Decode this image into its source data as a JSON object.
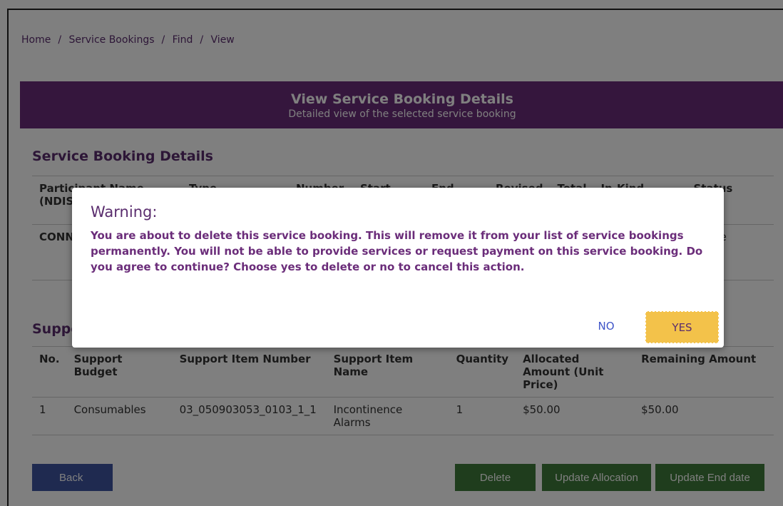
{
  "breadcrumb": [
    "Home",
    "Service Bookings",
    "Find",
    "View"
  ],
  "banner": {
    "title": "View Service Booking Details",
    "subtitle": "Detailed view of the selected service booking"
  },
  "booking_section": {
    "title": "Service Booking Details",
    "headers": [
      "Participant Name (NDIS",
      "Type",
      "Number",
      "Start Date",
      "End Date",
      "Revised",
      "Total",
      "In-Kind Program",
      "Status"
    ],
    "row": [
      "CONN (4302",
      "",
      "",
      "",
      "",
      "",
      "",
      "",
      "Active"
    ]
  },
  "support_section": {
    "title": "Supports",
    "headers": [
      "No.",
      "Support Budget",
      "Support Item Number",
      "Support Item Name",
      "Quantity",
      "Allocated Amount (Unit Price)",
      "Remaining Amount"
    ],
    "rows": [
      [
        "1",
        "Consumables",
        "03_050903053_0103_1_1",
        "Incontinence Alarms",
        "1",
        "$50.00",
        "$50.00"
      ]
    ]
  },
  "buttons": {
    "back": "Back",
    "delete": "Delete",
    "update_allocation": "Update Allocation",
    "update_end_date": "Update End date"
  },
  "modal": {
    "title": "Warning:",
    "message": "You are about to delete this service booking. This will remove it from your list of service bookings permanently. You will not be able to provide services or request payment on this service booking. Do you agree to continue? Choose yes to delete or no to cancel this action.",
    "no_label": "NO",
    "yes_label": "YES"
  },
  "colors": {
    "brand_purple": "#6b2d7a",
    "action_green": "#3e7a3a",
    "back_blue": "#3f55a0",
    "yes_yellow": "#f3c24a"
  }
}
